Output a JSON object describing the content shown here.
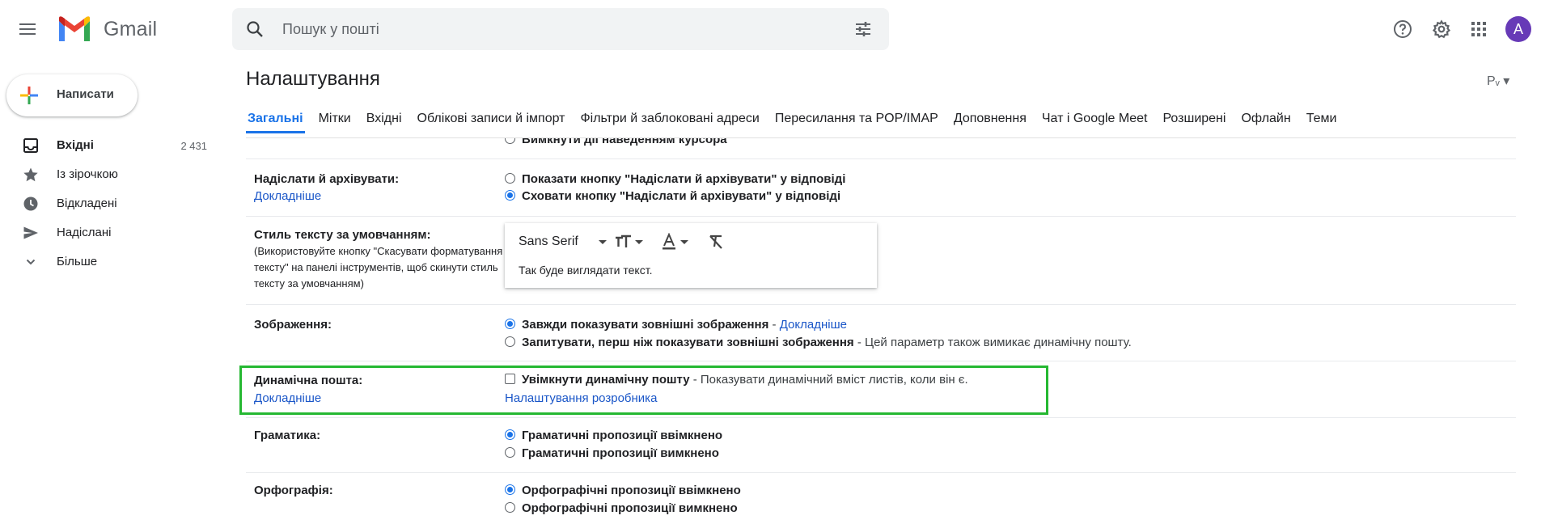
{
  "header": {
    "app_name": "Gmail",
    "search_placeholder": "Пошук у пошті",
    "avatar_letter": "A",
    "icons": [
      "menu-icon",
      "gmail-logo",
      "search-icon",
      "tune-icon",
      "help-icon",
      "gear-icon",
      "apps-grid-icon"
    ],
    "brand_colors": {
      "red": "#ea4335",
      "blue": "#4285f4",
      "green": "#34a853",
      "yellow": "#fbbc04",
      "avatar": "#673ab7"
    }
  },
  "sidebar": {
    "compose_label": "Написати",
    "items": [
      {
        "label": "Вхідні",
        "count": "2 431",
        "icon": "inbox-icon"
      },
      {
        "label": "Із зірочкою",
        "icon": "star-icon"
      },
      {
        "label": "Відкладені",
        "icon": "clock-icon"
      },
      {
        "label": "Надіслані",
        "icon": "send-icon"
      },
      {
        "label": "Більше",
        "icon": "chevron-down-icon"
      }
    ]
  },
  "main": {
    "title": "Налаштування",
    "lang_button": "Рᵥ ▾",
    "tabs": [
      {
        "label": "Загальні",
        "active": true
      },
      {
        "label": "Мітки"
      },
      {
        "label": "Вхідні"
      },
      {
        "label": "Облікові записи й імпорт"
      },
      {
        "label": "Фільтри й заблоковані адреси"
      },
      {
        "label": "Пересилання та POP/IMAP"
      },
      {
        "label": "Доповнення"
      },
      {
        "label": "Чат і Google Meet"
      },
      {
        "label": "Розширені"
      },
      {
        "label": "Офлайн"
      },
      {
        "label": "Теми"
      }
    ],
    "hover_actions_option": "Вимкнути дії наведенням курсора",
    "send_archive": {
      "label": "Надіслати й архівувати:",
      "link": "Докладніше",
      "options": [
        {
          "text": "Показати кнопку \"Надіслати й архівувати\" у відповіді",
          "selected": false
        },
        {
          "text": "Сховати кнопку \"Надіслати й архівувати\" у відповіді",
          "selected": true
        }
      ]
    },
    "text_style": {
      "label": "Стиль тексту за умовчанням:",
      "note": "(Використовуйте кнопку \"Скасувати форматування тексту\" на панелі інструментів, щоб скинути стиль тексту за умовчанням)",
      "font": "Sans Serif",
      "sample": "Так буде виглядати текст."
    },
    "images": {
      "label": "Зображення:",
      "opt1": "Завжди показувати зовнішні зображення",
      "opt1_link": "Докладніше",
      "opt1_selected": true,
      "opt2": "Запитувати, перш ніж показувати зовнішні зображення",
      "opt2_desc": "- Цей параметр також вимикає динамічну пошту.",
      "opt2_selected": false
    },
    "dynamic_mail": {
      "label": "Динамічна пошта:",
      "link": "Докладніше",
      "checkbox": "Увімкнути динамічну пошту",
      "checkbox_desc": "- Показувати динамічний вміст листів, коли він є.",
      "checked": false,
      "dev_link": "Налаштування розробника",
      "highlight_color": "#25b832"
    },
    "grammar": {
      "label": "Граматика:",
      "options": [
        {
          "text": "Граматичні пропозиції ввімкнено",
          "selected": true
        },
        {
          "text": "Граматичні пропозиції вимкнено",
          "selected": false
        }
      ]
    },
    "spelling": {
      "label": "Орфографія:",
      "options": [
        {
          "text": "Орфографічні пропозиції ввімкнено",
          "selected": true
        },
        {
          "text": "Орфографічні пропозиції вимкнено",
          "selected": false
        }
      ]
    }
  }
}
